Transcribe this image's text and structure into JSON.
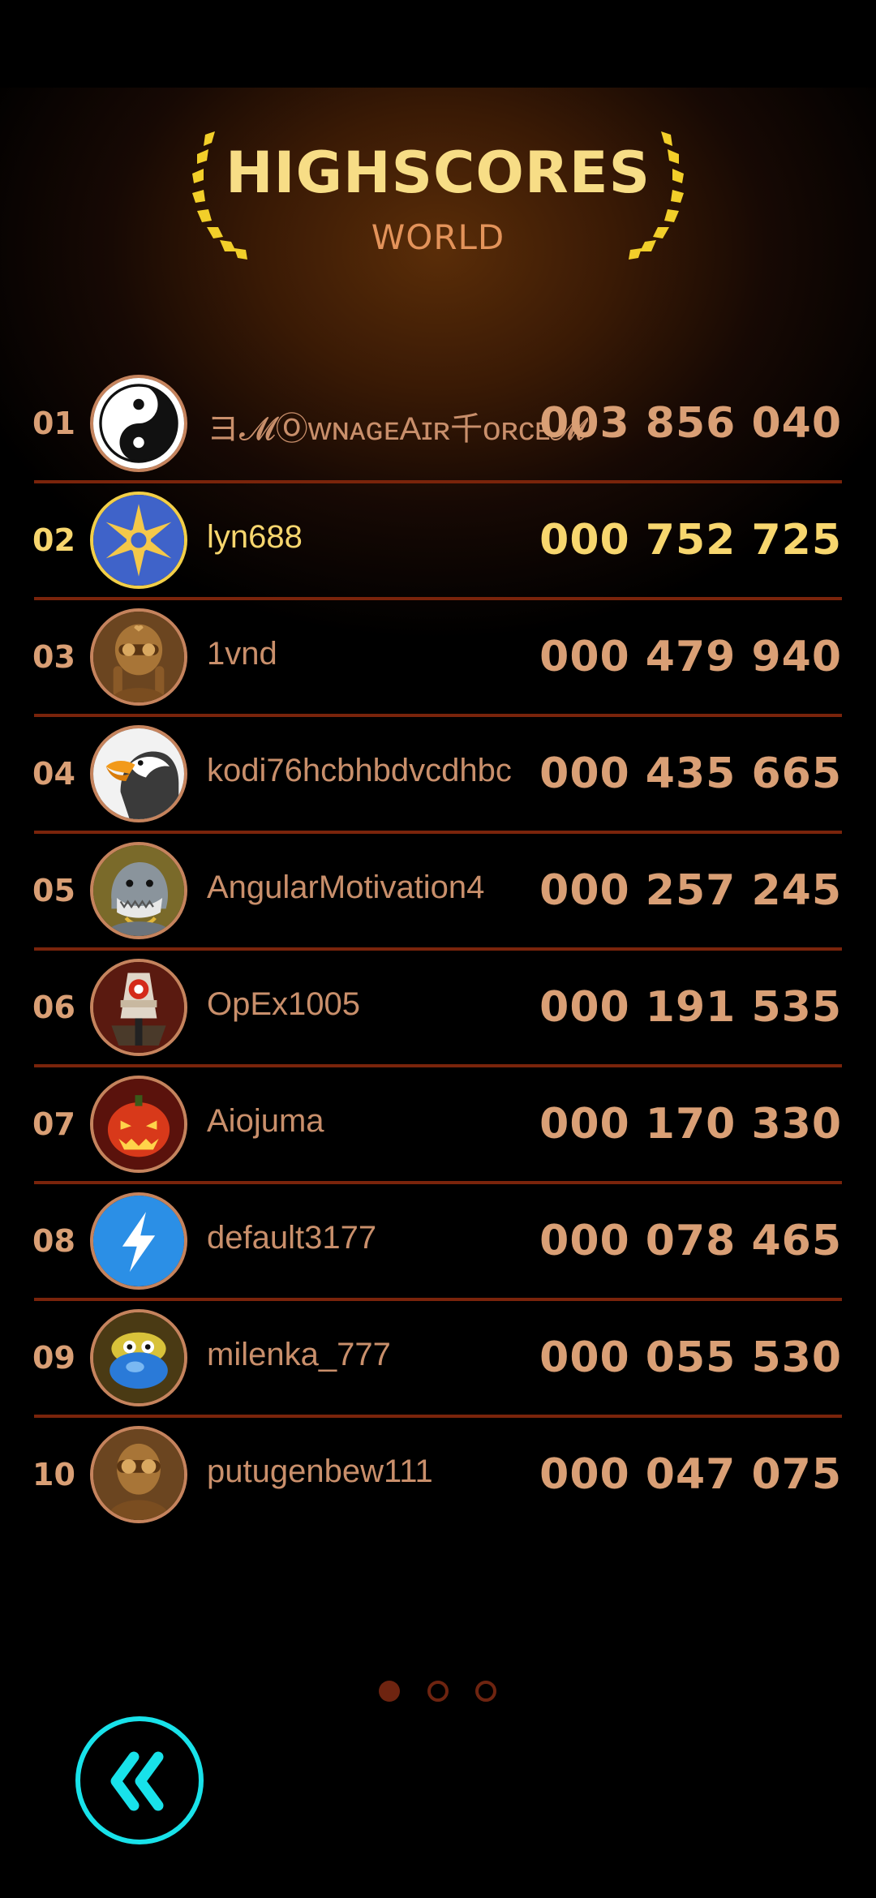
{
  "header": {
    "title": "HIGHSCORES",
    "subtitle": "WORLD"
  },
  "leaderboard": [
    {
      "rank": "01",
      "name": "ヨ𝓜ⓄᴡɴᴀɢᴇAɪʀ千ᴏʀᴄᴇ𝓜ち",
      "score": "003 856 040",
      "avatar_icon": "yin-yang-icon",
      "highlight": false
    },
    {
      "rank": "02",
      "name": "lyn688",
      "score": "000 752 725",
      "avatar_icon": "sun-star-icon",
      "highlight": true
    },
    {
      "rank": "03",
      "name": "1vnd",
      "score": "000 479 940",
      "avatar_icon": "aviator-girl-icon",
      "highlight": false
    },
    {
      "rank": "04",
      "name": "kodi76hcbhbdvcdhbc",
      "score": "000 435 665",
      "avatar_icon": "eagle-icon",
      "highlight": false
    },
    {
      "rank": "05",
      "name": "AngularMotivation4",
      "score": "000 257 245",
      "avatar_icon": "shark-icon",
      "highlight": false
    },
    {
      "rank": "06",
      "name": "OpEx1005",
      "score": "000 191 535",
      "avatar_icon": "robot-icon",
      "highlight": false
    },
    {
      "rank": "07",
      "name": "Aiojuma",
      "score": "000 170 330",
      "avatar_icon": "pumpkin-icon",
      "highlight": false
    },
    {
      "rank": "08",
      "name": "default3177",
      "score": "000 078 465",
      "avatar_icon": "lightning-icon",
      "highlight": false
    },
    {
      "rank": "09",
      "name": "milenka_777",
      "score": "000 055 530",
      "avatar_icon": "blue-creature-icon",
      "highlight": false
    },
    {
      "rank": "10",
      "name": "putugenbew111",
      "score": "000 047 075",
      "avatar_icon": "aviator-pilot-icon",
      "highlight": false
    }
  ],
  "pagination": {
    "pages": 3,
    "current": 1
  },
  "colors": {
    "title": "#f7dd86",
    "subtitle": "#e3935a",
    "highlight": "#f7d66e",
    "text": "#d99f75",
    "divider": "#7a240b",
    "back_button": "#18e2ea"
  },
  "back_button": {
    "icon": "double-chevron-left-icon"
  }
}
